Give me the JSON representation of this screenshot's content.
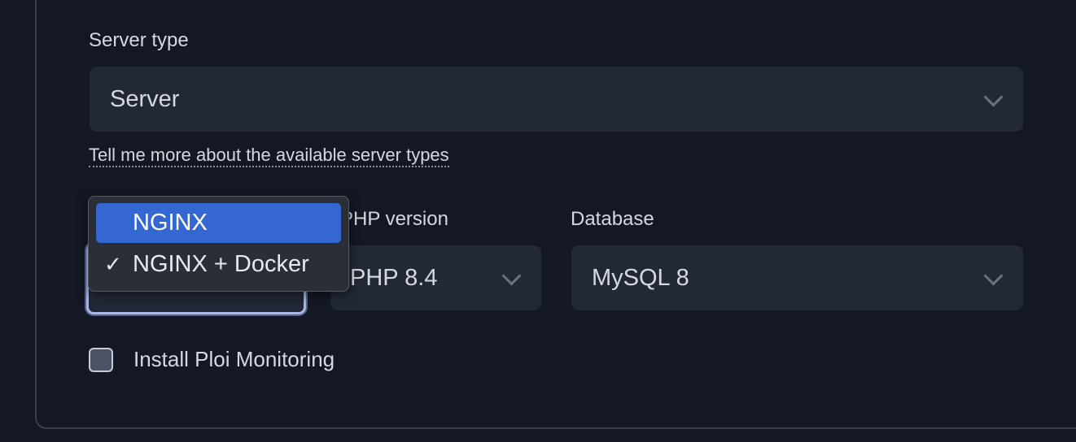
{
  "server_type": {
    "label": "Server type",
    "value": "Server"
  },
  "help_link": "Tell me more about the available server types",
  "php_version": {
    "label": "PHP version",
    "value": "PHP 8.4"
  },
  "database": {
    "label": "Database",
    "value": "MySQL 8"
  },
  "web_server": {
    "options": [
      {
        "label": "NGINX",
        "highlighted": true,
        "selected": false
      },
      {
        "label": "NGINX + Docker",
        "highlighted": false,
        "selected": true
      }
    ],
    "check_glyph": "✓"
  },
  "monitoring": {
    "label": "Install Ploi Monitoring",
    "checked": false
  },
  "colors": {
    "background": "#131824",
    "input": "#222836",
    "highlight": "#3467d1",
    "focus_ring": "#a9b7e4"
  }
}
